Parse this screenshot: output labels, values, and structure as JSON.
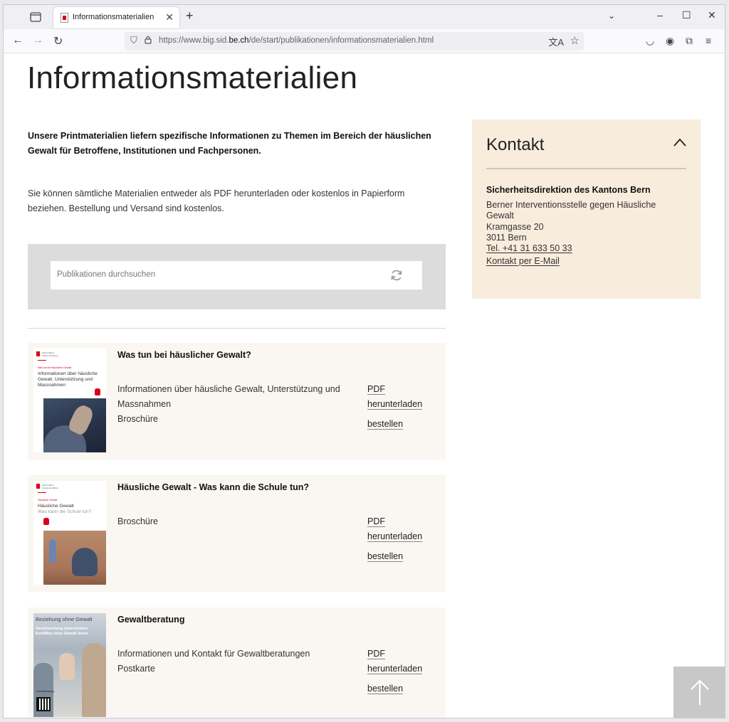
{
  "browser": {
    "tab_title": "Informationsmaterialien",
    "url_prefix": "https://www.big.sid.",
    "url_domain": "be.ch",
    "url_path": "/de/start/publikationen/informationsmaterialien.html"
  },
  "page": {
    "title": "Informationsmaterialien",
    "lead": "Unsere Printmaterialien liefern spezifische Informationen zu Themen im Bereich der häuslichen Gewalt für Betroffene, Institutionen und Fachpersonen.",
    "intro": "Sie können sämtliche Materialien entweder als PDF herunterladen oder kostenlos in Papierform beziehen. Bestellung und Versand sind kostenlos."
  },
  "search": {
    "placeholder": "Publikationen durchsuchen"
  },
  "publications": [
    {
      "title": "Was tun bei häuslicher Gewalt?",
      "description": "Informationen über häusliche Gewalt, Unterstützung und Massnahmen",
      "type": "Broschüre",
      "pdf_line1": "PDF",
      "pdf_line2": "herunterladen",
      "order_label": "bestellen",
      "thumb": {
        "logo_line1": "Kanton Bern",
        "logo_line2": "Canton de Berne",
        "kicker": "Was tun bei häuslicher Gewalt",
        "headline": "Informationen über häusliche Gewalt, Unterstützung und Massnahmen"
      }
    },
    {
      "title": "Häusliche Gewalt - Was kann die Schule tun?",
      "description": "",
      "type": "Broschüre",
      "pdf_line1": "PDF",
      "pdf_line2": "herunterladen",
      "order_label": "bestellen",
      "thumb": {
        "logo_line1": "Kanton Bern",
        "logo_line2": "Canton de Berne",
        "kicker": "Häusliche Gewalt",
        "headline": "Häusliche Gewalt",
        "subheadline": "Was kann die Schule tun?"
      }
    },
    {
      "title": "Gewaltberatung",
      "description": "Informationen und Kontakt für Gewaltberatungen",
      "type": "Postkarte",
      "pdf_line1": "PDF",
      "pdf_line2": "herunterladen",
      "order_label": "bestellen",
      "thumb": {
        "top": "Beziehung ohne Gewalt",
        "headline": "Verantwortung übernehmen Konflikte ohne Gewalt lösen",
        "foot": "Gewaltberatung"
      }
    }
  ],
  "kontakt": {
    "heading": "Kontakt",
    "org": "Sicherheitsdirektion des Kantons Bern",
    "line1": "Berner Interventionsstelle gegen Häusliche Gewalt",
    "street": "Kramgasse 20",
    "city": "3011 Bern",
    "tel": "Tel. +41 31 633 50 33",
    "mail": "Kontakt per E-Mail"
  },
  "colors": {
    "brand_red": "#d6001c",
    "card_bg": "#faf7f2",
    "kontakt_bg": "#f8ecdc",
    "search_bg": "#dcdcdc"
  }
}
